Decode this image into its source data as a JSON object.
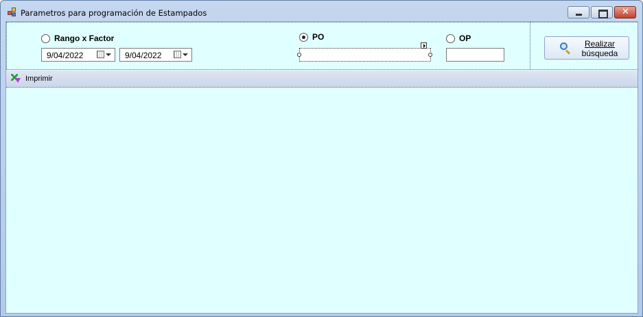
{
  "window": {
    "title": "Parametros para programación de Estampados"
  },
  "params": {
    "rango_label": "Rango x Factor",
    "date_from": "9/04/2022",
    "date_to": "9/04/2022",
    "po_label": "PO",
    "po_value": "",
    "po_selected": true,
    "op_label": "OP",
    "op_value": ""
  },
  "search": {
    "line1": "Realizar",
    "line2": "búsqueda"
  },
  "toolbar": {
    "print_label": "Imprimir"
  },
  "icons": {
    "app": "app-icon",
    "search": "magnifier-icon",
    "print": "print-icon"
  }
}
